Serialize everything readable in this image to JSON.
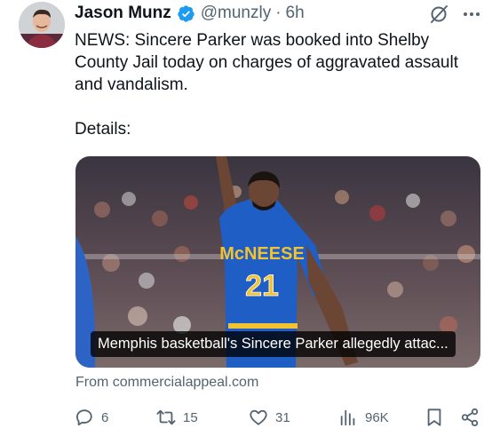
{
  "author": {
    "display_name": "Jason Munz",
    "handle": "@munzly",
    "separator": "·",
    "timestamp": "6h",
    "verified_color": "#1d9bf0"
  },
  "tweet": {
    "paragraphs": [
      "NEWS: Sincere Parker was booked into Shelby County Jail today on charges of aggravated assault and vandalism.",
      "Details:"
    ]
  },
  "card": {
    "caption": "Memphis basketball's Sincere Parker allegedly attac...",
    "jersey_text": "McNEESE",
    "jersey_number": "21",
    "source": "From commercialappeal.com"
  },
  "actions": {
    "replies": "6",
    "reposts": "15",
    "likes": "31",
    "views": "96K"
  },
  "icons": [
    "verified-badge-icon",
    "grok-icon",
    "more-icon",
    "reply-icon",
    "repost-icon",
    "like-icon",
    "views-icon",
    "bookmark-icon",
    "share-icon"
  ],
  "colors": {
    "text": "#0f1419",
    "secondary": "#536471",
    "jersey_blue": "#1f5ec4",
    "jersey_gold": "#f2c230"
  }
}
